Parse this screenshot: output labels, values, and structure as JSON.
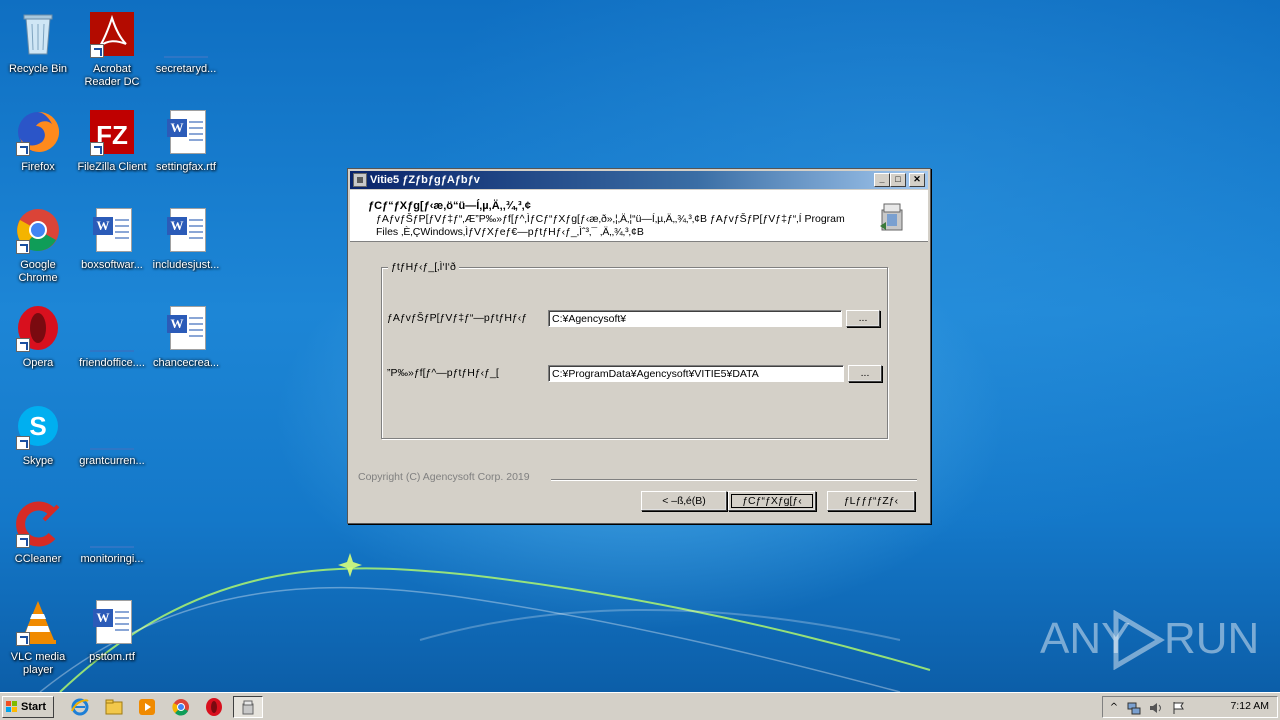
{
  "desktop": {
    "icons": [
      {
        "label": "Recycle Bin",
        "icon": "recycle-bin-icon"
      },
      {
        "label": "Acrobat Reader DC",
        "icon": "acrobat-icon"
      },
      {
        "label": "secretaryd...",
        "icon": "file-icon"
      },
      {
        "label": "Firefox",
        "icon": "firefox-icon"
      },
      {
        "label": "FileZilla Client",
        "icon": "filezilla-icon"
      },
      {
        "label": "settingfax.rtf",
        "icon": "word-doc-icon"
      },
      {
        "label": "Google Chrome",
        "icon": "chrome-icon"
      },
      {
        "label": "boxsoftwar...",
        "icon": "word-doc-icon"
      },
      {
        "label": "includesjust...",
        "icon": "word-doc-icon"
      },
      {
        "label": "Opera",
        "icon": "opera-icon"
      },
      {
        "label": "friendoffice....",
        "icon": "file-icon"
      },
      {
        "label": "chancecrea...",
        "icon": "word-doc-icon"
      },
      {
        "label": "Skype",
        "icon": "skype-icon"
      },
      {
        "label": "grantcurren...",
        "icon": "file-icon"
      },
      {
        "label": "CCleaner",
        "icon": "ccleaner-icon"
      },
      {
        "label": "monitoringi...",
        "icon": "file-icon"
      },
      {
        "label": "VLC media player",
        "icon": "vlc-icon"
      },
      {
        "label": "psttom.rtf",
        "icon": "word-doc-icon"
      }
    ]
  },
  "window": {
    "title": "Vitie5 ƒZƒbƒgƒAƒbƒv",
    "header_title": "ƒCƒ“ƒXƒg[ƒ‹æ‚ö“ü—Í‚µ‚Ä‚­‚¾‚³‚¢",
    "header_desc": "ƒAƒvƒŠƒP[ƒVƒ‡ƒ“‚Æ”P‰»ƒf[ƒ^‚ÌƒCƒ“ƒXƒg[ƒ‹æ‚ð»‚¦‚Ä‚¦“ü—Í‚µ‚Ä‚­‚¾‚³‚¢B ƒAƒvƒŠƒP[ƒVƒ‡ƒ“‚Í Program Files ‚È‚ÇWindows‚ÌƒVƒXƒeƒ€—pƒtƒHƒ‹ƒ_‚Ìˆ³‚¯ ‚Ä‚­‚¾‚³‚¢B",
    "group_title": "ƒtƒHƒ‹ƒ_[‚Ì‘I‘ð",
    "app_folder_label": "ƒAƒvƒŠƒP[ƒVƒ‡ƒ“—pƒtƒHƒ‹ƒ",
    "app_folder_value": "C:¥Agencysoft¥",
    "data_folder_label": "”P‰»ƒf[ƒ^—pƒtƒHƒ‹ƒ_[",
    "data_folder_value": "C:¥ProgramData¥Agencysoft¥VITIE5¥DATA",
    "browse_label": "...",
    "copyright": "Copyright (C) Agencysoft Corp. 2019",
    "back_label": "< –ß‚é(B)",
    "install_label": "ƒCƒ“ƒXƒg[ƒ‹",
    "cancel_label": "ƒLƒƒƒ“ƒZƒ‹",
    "min_glyph": "_",
    "max_glyph": "□",
    "close_glyph": "✕"
  },
  "watermark": {
    "left": "ANY",
    "right": "RUN"
  },
  "taskbar": {
    "start_label": "Start",
    "clock": "7:12 AM",
    "pinned": [
      "ie-icon",
      "explorer-icon",
      "media-player-icon",
      "chrome-icon",
      "opera-icon",
      "setup-task-icon"
    ]
  }
}
